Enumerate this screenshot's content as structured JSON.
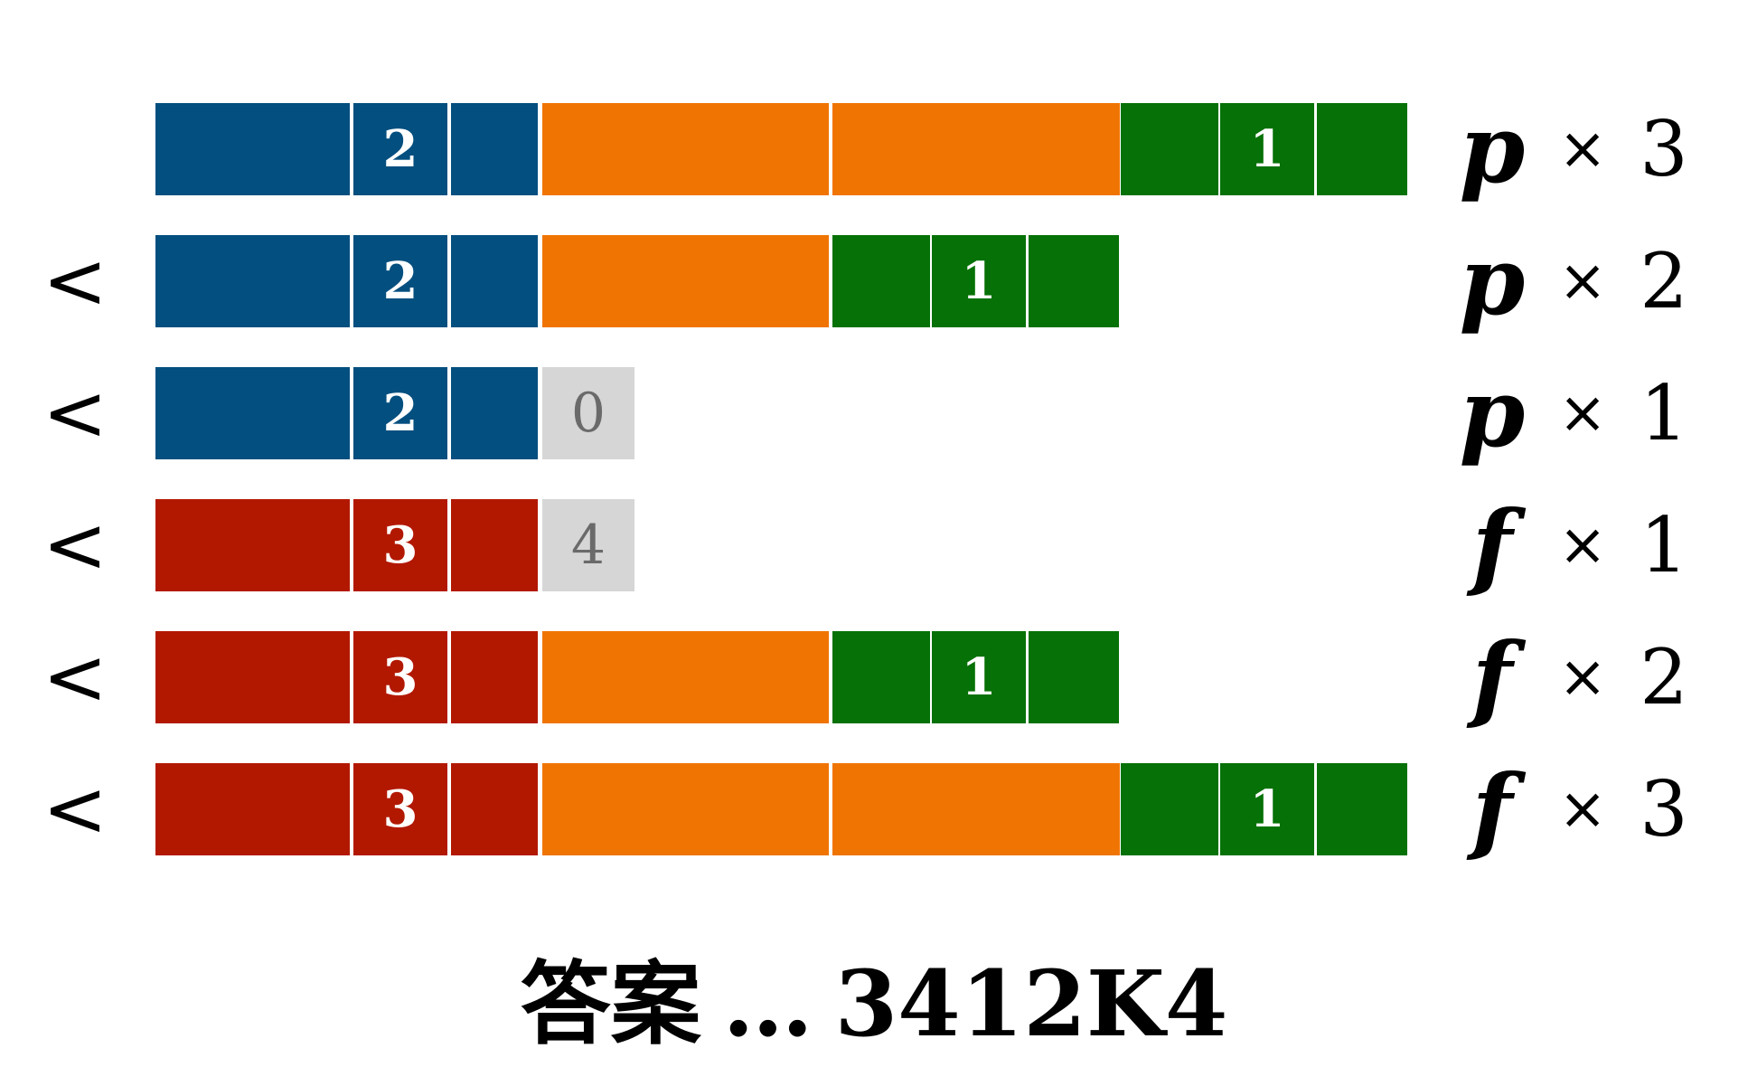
{
  "less_than_symbol": "<",
  "times_symbol": "×",
  "colors": {
    "blue": "#034f7f",
    "red": "#b21800",
    "orange": "#f07402",
    "green": "#067106",
    "gray": "#d6d6d6"
  },
  "rows": [
    {
      "comparator": "",
      "symbol": "p",
      "multiplier": "3",
      "cells": [
        {
          "color": "blue",
          "text": ""
        },
        {
          "color": "blue",
          "text": "2"
        },
        {
          "color": "blue",
          "text": ""
        },
        {
          "color": "orange",
          "text": ""
        },
        {
          "color": "orange",
          "text": ""
        },
        {
          "color": "green",
          "text": ""
        },
        {
          "color": "green",
          "text": "1"
        },
        {
          "color": "green",
          "text": ""
        }
      ]
    },
    {
      "comparator": "<",
      "symbol": "p",
      "multiplier": "2",
      "cells": [
        {
          "color": "blue",
          "text": ""
        },
        {
          "color": "blue",
          "text": "2"
        },
        {
          "color": "blue",
          "text": ""
        },
        {
          "color": "orange",
          "text": ""
        },
        {
          "color": "green",
          "text": ""
        },
        {
          "color": "green",
          "text": "1"
        },
        {
          "color": "green",
          "text": ""
        }
      ]
    },
    {
      "comparator": "<",
      "symbol": "p",
      "multiplier": "1",
      "cells": [
        {
          "color": "blue",
          "text": ""
        },
        {
          "color": "blue",
          "text": "2"
        },
        {
          "color": "blue",
          "text": ""
        },
        {
          "color": "gray",
          "text": "0"
        }
      ]
    },
    {
      "comparator": "<",
      "symbol": "f",
      "multiplier": "1",
      "cells": [
        {
          "color": "red",
          "text": ""
        },
        {
          "color": "red",
          "text": "3"
        },
        {
          "color": "red",
          "text": ""
        },
        {
          "color": "gray",
          "text": "4"
        }
      ]
    },
    {
      "comparator": "<",
      "symbol": "f",
      "multiplier": "2",
      "cells": [
        {
          "color": "red",
          "text": ""
        },
        {
          "color": "red",
          "text": "3"
        },
        {
          "color": "red",
          "text": ""
        },
        {
          "color": "orange",
          "text": ""
        },
        {
          "color": "green",
          "text": ""
        },
        {
          "color": "green",
          "text": "1"
        },
        {
          "color": "green",
          "text": ""
        }
      ]
    },
    {
      "comparator": "<",
      "symbol": "f",
      "multiplier": "3",
      "cells": [
        {
          "color": "red",
          "text": ""
        },
        {
          "color": "red",
          "text": "3"
        },
        {
          "color": "red",
          "text": ""
        },
        {
          "color": "orange",
          "text": ""
        },
        {
          "color": "orange",
          "text": ""
        },
        {
          "color": "green",
          "text": ""
        },
        {
          "color": "green",
          "text": "1"
        },
        {
          "color": "green",
          "text": ""
        }
      ]
    }
  ],
  "answer": {
    "label": "答案",
    "separator": "…",
    "value": "3412K4"
  }
}
